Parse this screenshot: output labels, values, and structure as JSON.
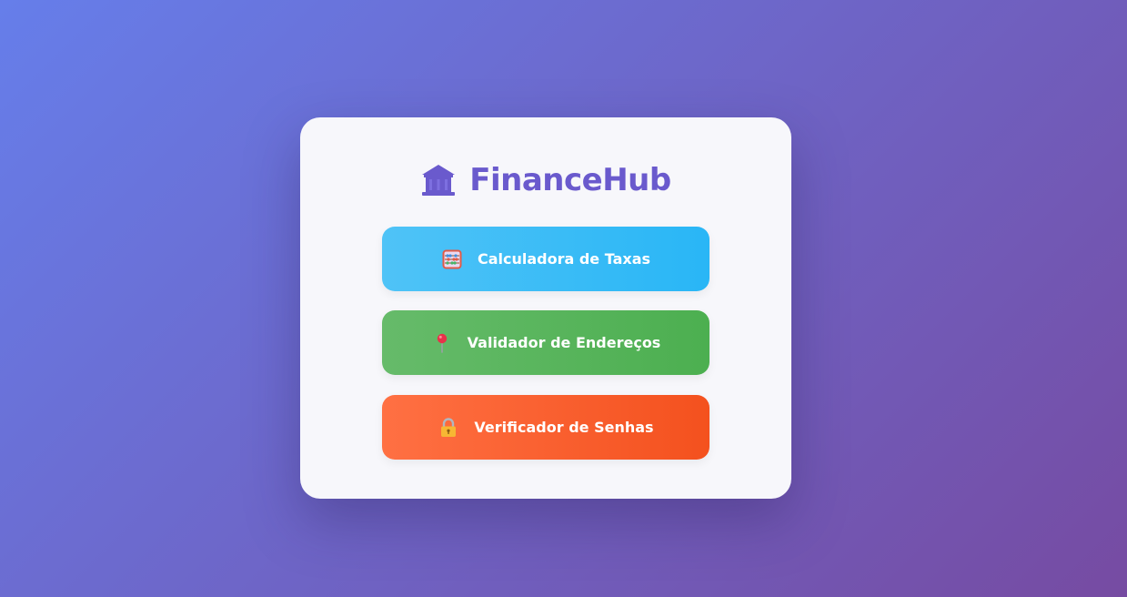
{
  "app": {
    "title": "FinanceHub",
    "logo_icon": "bank-icon",
    "accent_color": "#6a5acd"
  },
  "nav": {
    "buttons": [
      {
        "label": "Calculadora de Taxas",
        "icon": "abacus-icon",
        "color": "#29b6f6"
      },
      {
        "label": "Validador de Endereços",
        "icon": "map-pin-icon",
        "color": "#4caf50"
      },
      {
        "label": "Verificador de Senhas",
        "icon": "padlock-icon",
        "color": "#f4511e"
      }
    ]
  }
}
